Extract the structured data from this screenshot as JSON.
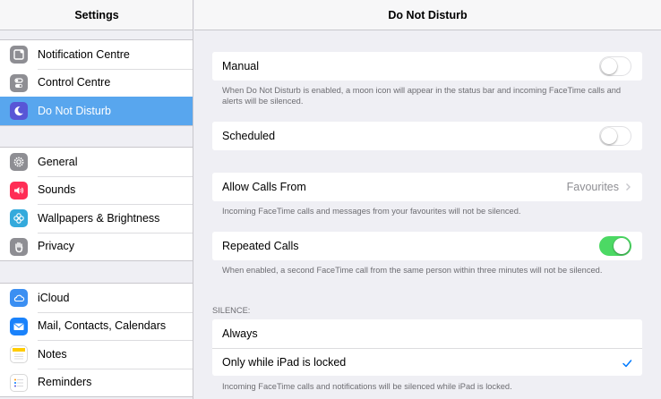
{
  "sidebar": {
    "title": "Settings",
    "groups": [
      {
        "items": [
          {
            "label": "Notification Centre",
            "icon": "notification-centre-icon",
            "color": "#8e8e93"
          },
          {
            "label": "Control Centre",
            "icon": "control-centre-icon",
            "color": "#8e8e93"
          },
          {
            "label": "Do Not Disturb",
            "icon": "moon-icon",
            "color": "#5856d6",
            "selected": true
          }
        ]
      },
      {
        "items": [
          {
            "label": "General",
            "icon": "gear-icon",
            "color": "#8e8e93"
          },
          {
            "label": "Sounds",
            "icon": "speaker-icon",
            "color": "#ff2d55"
          },
          {
            "label": "Wallpapers & Brightness",
            "icon": "flower-icon",
            "color": "#34aadc"
          },
          {
            "label": "Privacy",
            "icon": "hand-icon",
            "color": "#8e8e93"
          }
        ]
      },
      {
        "items": [
          {
            "label": "iCloud",
            "icon": "cloud-icon",
            "color": "#3b8ff2"
          },
          {
            "label": "Mail, Contacts, Calendars",
            "icon": "envelope-icon",
            "color": "#1a82fb"
          },
          {
            "label": "Notes",
            "icon": "notes-icon",
            "color": "#ffcc00"
          },
          {
            "label": "Reminders",
            "icon": "list-icon",
            "color": "#ffffff"
          }
        ]
      }
    ]
  },
  "main": {
    "title": "Do Not Disturb",
    "manual": {
      "label": "Manual",
      "on": false,
      "footnote": "When Do Not Disturb is enabled, a moon icon will appear in the status bar and incoming FaceTime calls and alerts will be silenced."
    },
    "scheduled": {
      "label": "Scheduled",
      "on": false
    },
    "allow_calls": {
      "label": "Allow Calls From",
      "value": "Favourites",
      "footnote": "Incoming FaceTime calls and messages from your favourites will not be silenced."
    },
    "repeated_calls": {
      "label": "Repeated Calls",
      "on": true,
      "footnote": "When enabled, a second FaceTime call from the same person within three minutes will not be silenced."
    },
    "silence": {
      "header": "SILENCE:",
      "options": [
        {
          "label": "Always",
          "checked": false
        },
        {
          "label": "Only while iPad is locked",
          "checked": true
        }
      ],
      "footnote": "Incoming FaceTime calls and notifications will be silenced while iPad is locked."
    },
    "colors": {
      "accent": "#007aff",
      "selection": "#58a6ee",
      "toggle_on": "#4cd964"
    }
  }
}
